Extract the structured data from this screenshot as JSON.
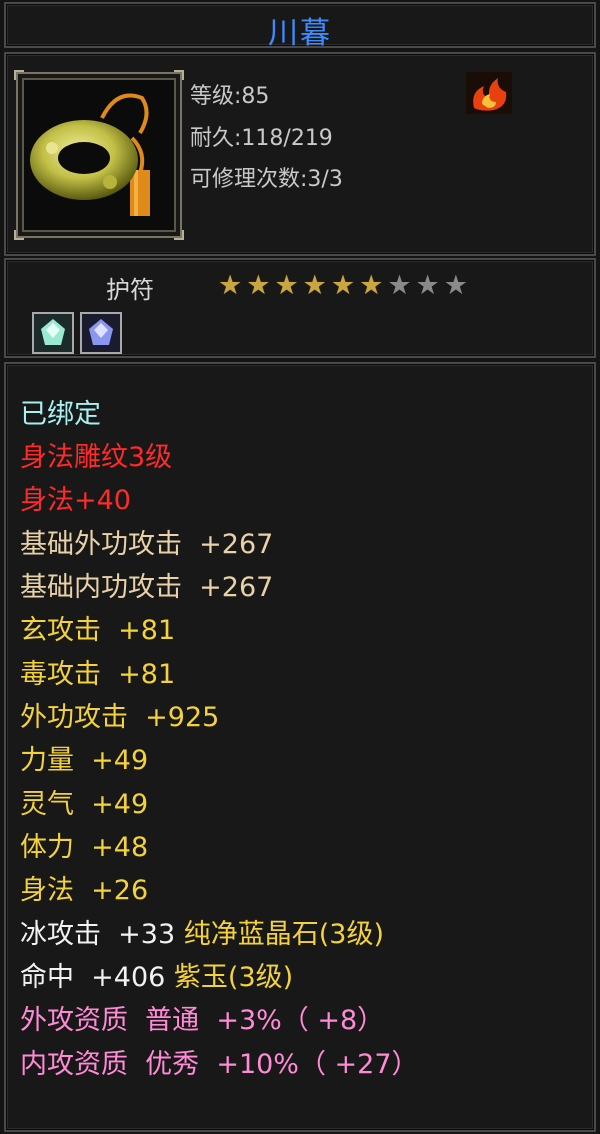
{
  "item": {
    "name": "川暮",
    "level_text": "等级:85",
    "durability_text": "耐久:118/219",
    "repair_text": "可修理次数:3/3",
    "type_label": "护符",
    "stars_total": 9,
    "stars_filled": 6,
    "gems": [
      "green-gem-icon",
      "blue-gem-icon"
    ],
    "element_icon": "fire-icon"
  },
  "attributes": {
    "bound": "已绑定",
    "engrave_name": "身法雕纹3级",
    "engrave_bonus": "身法+40",
    "base_ext_attack": "基础外功攻击  +267",
    "base_int_attack": "基础内功攻击  +267",
    "mystic_attack": "玄攻击  +81",
    "poison_attack": "毒攻击  +81",
    "ext_attack": "外功攻击  +925",
    "strength": "力量  +49",
    "spirit": "灵气  +49",
    "stamina": "体力  +48",
    "agility": "身法  +26",
    "ice_attack": "冰攻击  +33",
    "ice_gem": "纯净蓝晶石(3级)",
    "hit": "命中  +406",
    "hit_gem": "紫玉(3级)",
    "ext_quality": "外攻资质  普通  +3%（ +8）",
    "int_quality": "内攻资质  优秀  +10%（ +27）"
  },
  "colors": {
    "title": "#3d8cff",
    "bound": "#a8f0f0",
    "engrave": "#ff2a2a",
    "base": "#e9d2a7",
    "bonus": "#f4d23c",
    "gem_stat": "#f2f2f2",
    "quality": "#ff8ad6"
  }
}
